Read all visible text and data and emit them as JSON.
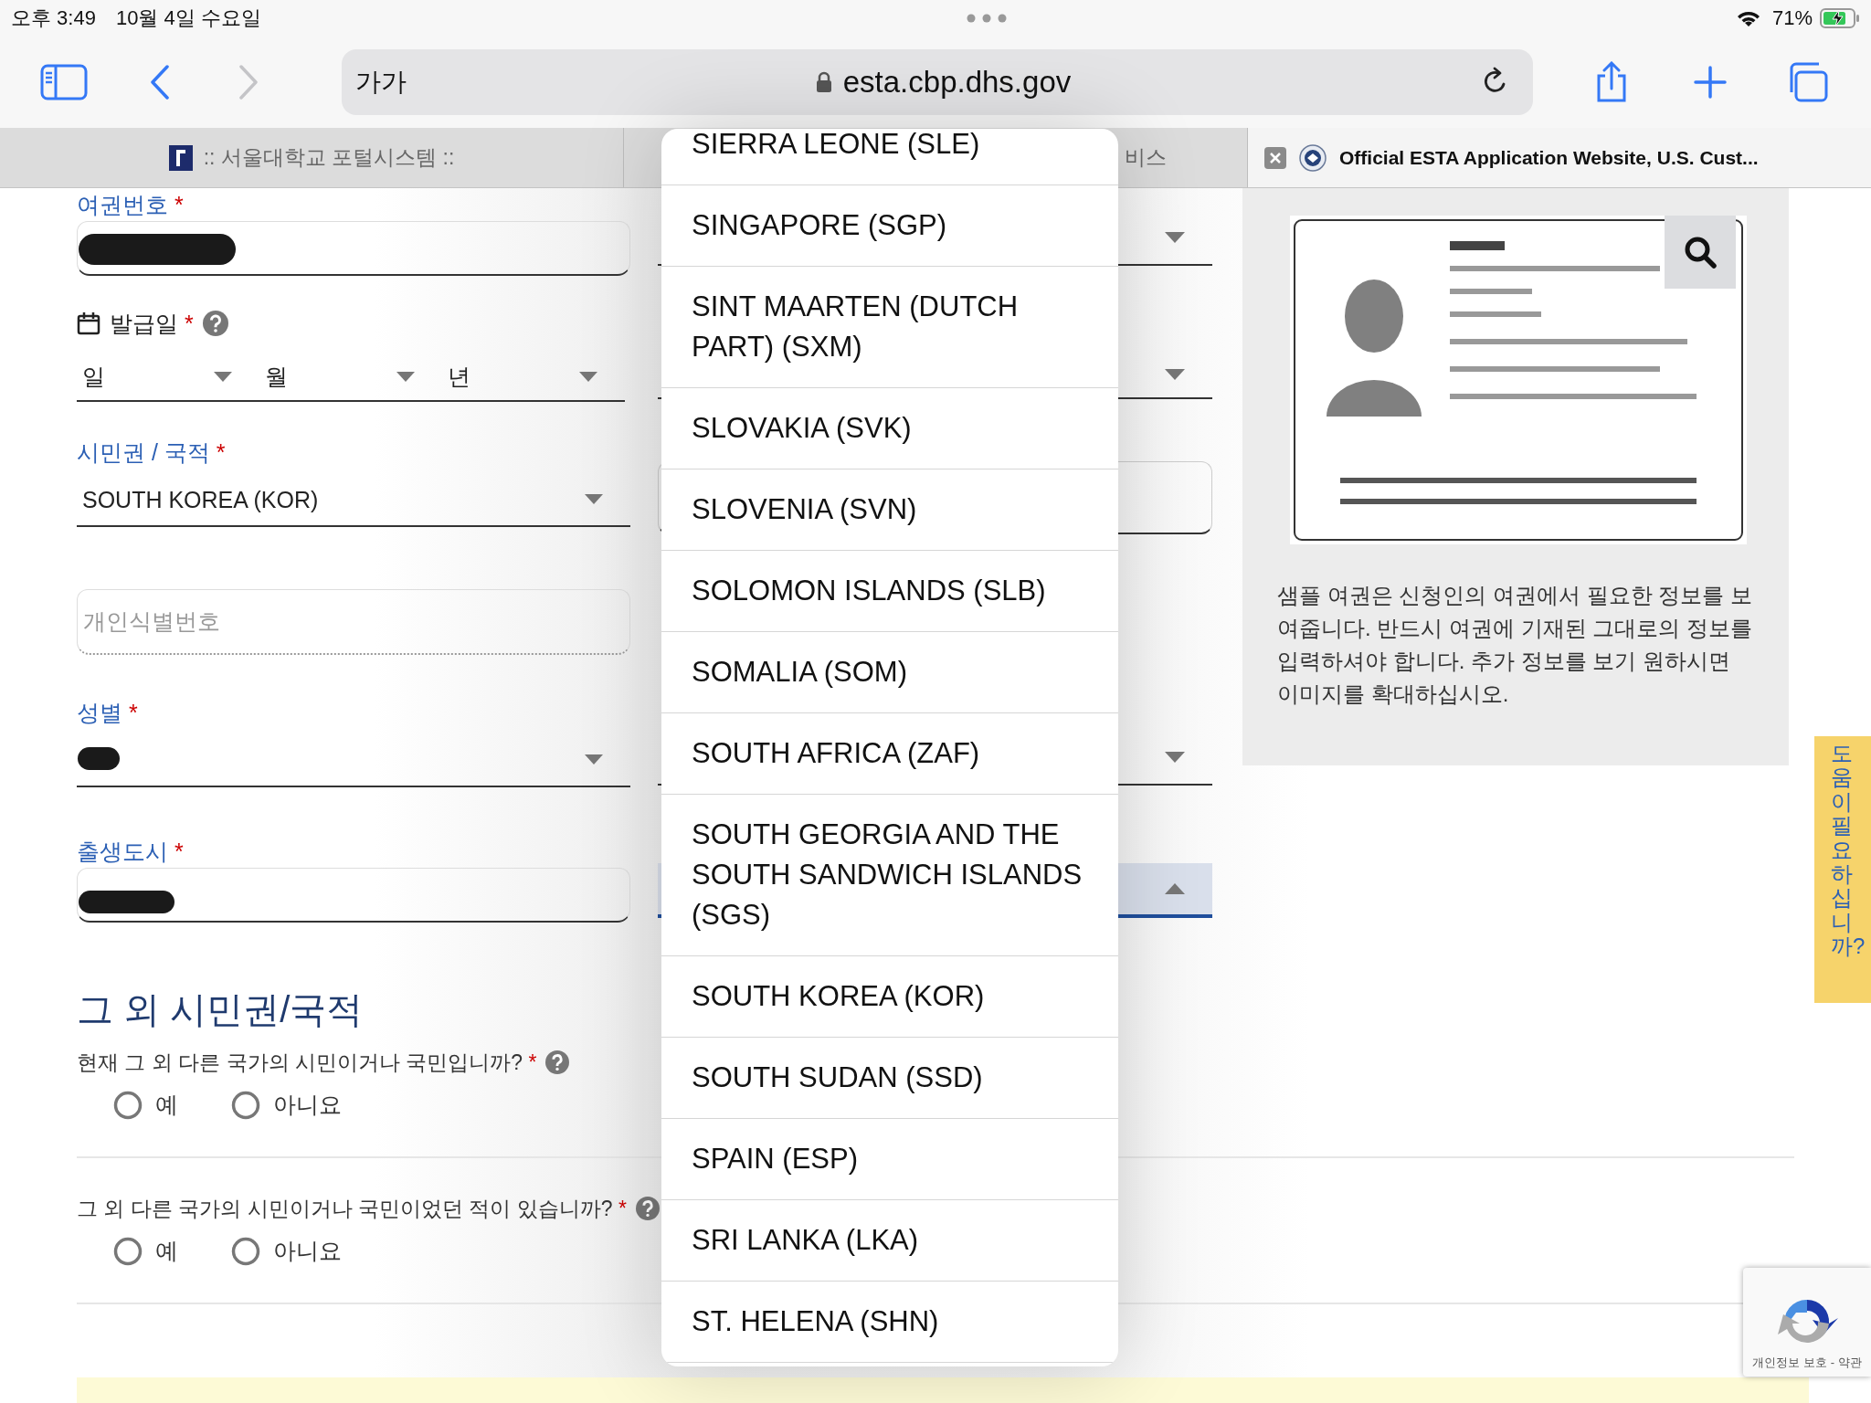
{
  "status_bar": {
    "time": "오후 3:49",
    "date": "10월 4일 수요일",
    "battery": "71%"
  },
  "browser": {
    "text_size": "가가",
    "url": "esta.cbp.dhs.gov"
  },
  "tabs": [
    {
      "title": ":: 서울대학교 포털시스템 ::",
      "selected": false
    },
    {
      "title": "비스",
      "selected": false
    },
    {
      "title": "Official ESTA Application Website, U.S. Cust...",
      "selected": true
    }
  ],
  "fields": [
    {
      "kind": "text",
      "label": "여권번호",
      "mark": "*",
      "redacted": true
    },
    {
      "kind": "date",
      "label": "발급일",
      "mark": "*",
      "help": true,
      "parts": [
        "일",
        "월",
        "년"
      ]
    },
    {
      "kind": "select",
      "label": "시민권 / 국적",
      "mark": "*",
      "value": "SOUTH KOREA (KOR)"
    },
    {
      "kind": "text",
      "placeholder": "개인식별번호"
    },
    {
      "kind": "select",
      "label": "성별",
      "mark": "*",
      "redacted": true
    },
    {
      "kind": "text",
      "label": "출생도시",
      "mark": "*",
      "redacted": true
    }
  ],
  "middle_fields": [
    {
      "kind": "select",
      "expanded": false
    },
    {
      "kind": "select",
      "expanded": false
    },
    {
      "kind": "text"
    },
    {
      "kind": "select",
      "expanded": false
    },
    {
      "kind": "select",
      "expanded": true
    }
  ],
  "section": {
    "heading": "그 외 시민권/국적",
    "questions": [
      {
        "text": "현재 그 외 다른 국가의 시민이거나 국민입니까?",
        "mark": "*",
        "help": true,
        "options": [
          {
            "label": "예",
            "selected": false
          },
          {
            "label": "아니요",
            "selected": false
          }
        ]
      },
      {
        "text": "그 외 다른 국가의 시민이거나 국민이었던 적이 있습니까?",
        "mark": "*",
        "help": true,
        "options": [
          {
            "label": "예",
            "selected": false
          },
          {
            "label": "아니요",
            "selected": false
          }
        ]
      }
    ]
  },
  "sample": {
    "caption": "샘플 여권은 신청인의 여권에서 필요한 정보를 보여줍니다. 반드시 여권에 기재된 그대로의 정보를 입력하셔야 합니다. 추가 정보를 보기 원하시면 이미지를 확대하십시오."
  },
  "dropdown": {
    "options": [
      "SIERRA LEONE (SLE)",
      "SINGAPORE (SGP)",
      "SINT MAARTEN (DUTCH PART) (SXM)",
      "SLOVAKIA (SVK)",
      "SLOVENIA (SVN)",
      "SOLOMON ISLANDS (SLB)",
      "SOMALIA (SOM)",
      "SOUTH AFRICA (ZAF)",
      "SOUTH GEORGIA AND THE SOUTH SANDWICH ISLANDS (SGS)",
      "SOUTH KOREA (KOR)",
      "SOUTH SUDAN (SSD)",
      "SPAIN (ESP)",
      "SRI LANKA (LKA)",
      "ST. HELENA (SHN)"
    ]
  },
  "help_tab": "도움이 필요하십니까?",
  "recaptcha": "개인정보 보호 - 약관"
}
